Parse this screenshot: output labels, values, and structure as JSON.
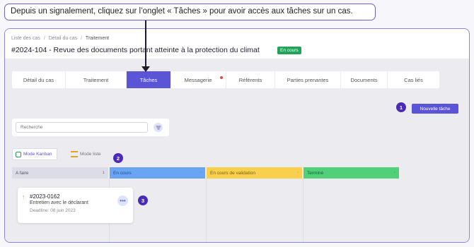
{
  "callout": {
    "text": "Depuis un signalement, cliquez sur l’onglet « Tâches » pour avoir accès aux tâches sur un cas."
  },
  "breadcrumb": {
    "items": [
      "Liste des cas",
      "Détail du cas",
      "Traitement"
    ],
    "separator": "/"
  },
  "case": {
    "title": "#2024-104 - Revue des documents portant atteinte à la protection du climat",
    "status": "En cours",
    "status_color": "#22a35a"
  },
  "tabs": [
    {
      "label": "Détail du cas",
      "active": false
    },
    {
      "label": "Traitement",
      "active": false
    },
    {
      "label": "Tâches",
      "active": true
    },
    {
      "label": "Messagerie",
      "active": false,
      "notification": true
    },
    {
      "label": "Référents",
      "active": false
    },
    {
      "label": "Parties prenantes",
      "active": false
    },
    {
      "label": "Documents",
      "active": false
    },
    {
      "label": "Cas liés",
      "active": false
    }
  ],
  "accent_color": "#5b54d6",
  "toolbar": {
    "new_task_label": "Nouvelle tâche"
  },
  "search": {
    "placeholder": "Recherche",
    "icon": "filter-icon"
  },
  "view_modes": {
    "kanban_label": "Mode Kanban",
    "kanban_icon": "kanban-icon",
    "list_label": "Mode liste",
    "list_icon": "list-icon"
  },
  "columns": [
    {
      "label": "A faire",
      "count_hint": "1",
      "color": "#dcdce6"
    },
    {
      "label": "En cours",
      "color": "#6aa5f3"
    },
    {
      "label": "En cours de validation",
      "color": "#f9d04e"
    },
    {
      "label": "Terminé",
      "color": "#51cf79"
    }
  ],
  "task": {
    "id": "#2023-0162",
    "name": "Entretien avec le déclarant",
    "deadline": "Deadline: 08 juin 2023",
    "priority_icon": "arrow-up-icon",
    "menu_icon": "more-dots-icon"
  },
  "annotations": {
    "badge1": "1",
    "badge2": "2",
    "badge3": "3"
  }
}
